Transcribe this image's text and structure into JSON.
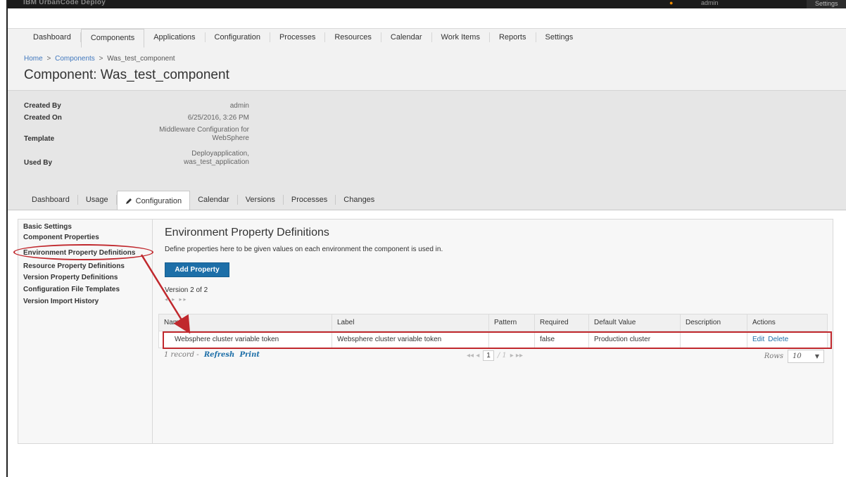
{
  "topbar": {
    "app_name": "IBM UrbanCode Deploy",
    "user_label": "admin",
    "right_label": "Settings"
  },
  "nav": {
    "items": [
      "Dashboard",
      "Components",
      "Applications",
      "Configuration",
      "Processes",
      "Resources",
      "Calendar",
      "Work Items",
      "Reports",
      "Settings"
    ],
    "active": "Components"
  },
  "breadcrumb": {
    "home": "Home",
    "components": "Components",
    "current": "Was_test_component",
    "separator": ">"
  },
  "page_title": "Component: Was_test_component",
  "summary": {
    "created_by_label": "Created By",
    "created_by_value": "admin",
    "created_on_label": "Created On",
    "created_on_value": "6/25/2016, 3:26 PM",
    "template_label": "Template",
    "template_value_line1": "Middleware Configuration for",
    "template_value_line2": "WebSphere",
    "used_by_label": "Used By",
    "used_by_value_line1": "Deployapplication,",
    "used_by_value_line2": "was_test_application"
  },
  "subtabs": {
    "items": [
      "Dashboard",
      "Usage",
      "Configuration",
      "Calendar",
      "Versions",
      "Processes",
      "Changes"
    ],
    "active": "Configuration"
  },
  "left_menu": [
    "Basic Settings",
    "Component Properties",
    "Environment Property Definitions",
    "Resource Property Definitions",
    "Version Property Definitions",
    "Configuration File Templates",
    "Version Import History"
  ],
  "panel": {
    "title": "Environment Property Definitions",
    "description": "Define properties here to be given values on each environment the component is used in.",
    "add_button": "Add Property",
    "version_text": "Version 2 of 2",
    "mini_pager": "◂  ▸  ▸▸"
  },
  "table": {
    "columns": [
      "Name",
      "Label",
      "Pattern",
      "Required",
      "Default Value",
      "Description",
      "Actions"
    ],
    "rows": [
      {
        "name": "Websphere cluster variable token",
        "label": "Websphere cluster variable token",
        "pattern": "",
        "required": "false",
        "default_value": "Production cluster",
        "description": "",
        "edit": "Edit",
        "delete": "Delete"
      }
    ]
  },
  "footer": {
    "count": "1 record",
    "dash": "-",
    "refresh": "Refresh",
    "print": "Print",
    "pager_first_prev": "◂◂  ◂",
    "page": "1",
    "of_total": "/ 1",
    "pager_next_last": "▸  ▸▸",
    "rows_label": "Rows",
    "rows_value": "10"
  },
  "colors": {
    "accent": "#1d6fa8",
    "annotation": "#c0282d",
    "link": "#4178be"
  }
}
